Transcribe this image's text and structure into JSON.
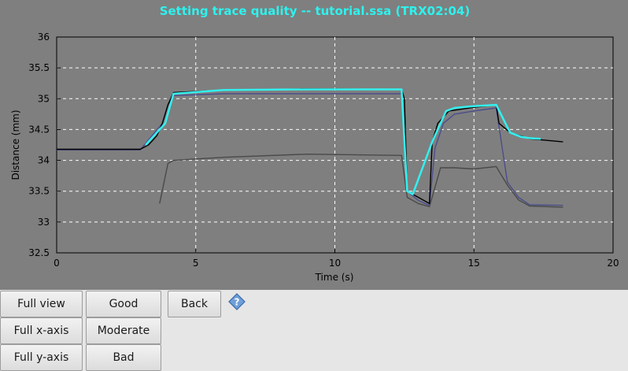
{
  "window": {
    "title": "Setting trace quality -- tutorial.ssa (TRX02:04)"
  },
  "colors": {
    "plot_background": "#7f7f7f",
    "title_color": "#2ef2ee",
    "trace_black": "#000000",
    "trace_cyan": "#33f0f0",
    "trace_blue": "#4b4d8c",
    "trace_gray": "#4a4a4a"
  },
  "chart_data": {
    "type": "line",
    "title": "Setting trace quality -- tutorial.ssa (TRX02:04)",
    "xlabel": "Time (s)",
    "ylabel": "Distance (mm)",
    "xlim": [
      0,
      20
    ],
    "ylim": [
      32.5,
      36
    ],
    "xticks": [
      0,
      5,
      10,
      15,
      20
    ],
    "yticks": [
      32.5,
      33,
      33.5,
      34,
      34.5,
      35,
      35.5,
      36
    ],
    "grid": true,
    "series": [
      {
        "color": "#000000",
        "x": [
          0,
          3.0,
          3.3,
          3.6,
          3.8,
          4.0,
          4.2,
          6,
          9,
          12.4,
          12.5,
          12.6,
          13.0,
          13.4,
          13.5,
          13.7,
          14.1,
          15,
          15.8,
          15.9,
          16.3,
          17,
          18.2
        ],
        "y": [
          34.18,
          34.18,
          34.25,
          34.4,
          34.6,
          34.9,
          35.1,
          35.14,
          35.16,
          35.15,
          35.0,
          33.5,
          33.4,
          33.3,
          34.3,
          34.6,
          34.8,
          34.86,
          34.9,
          34.6,
          34.45,
          34.35,
          34.3
        ]
      },
      {
        "color": "#33f0f0",
        "x": [
          3.2,
          3.6,
          3.9,
          4.2,
          6,
          9,
          12.4,
          12.6,
          12.8,
          13.5,
          13.8,
          14.0,
          14.3,
          15.0,
          15.8,
          16.3,
          16.7,
          17.0,
          17.4
        ],
        "y": [
          34.25,
          34.45,
          34.6,
          35.08,
          35.14,
          35.15,
          35.15,
          33.5,
          33.45,
          34.3,
          34.6,
          34.8,
          34.85,
          34.88,
          34.9,
          34.45,
          34.38,
          34.36,
          34.35
        ]
      },
      {
        "color": "#4b4d8c",
        "x": [
          0,
          3.0,
          3.8,
          4.0,
          4.2,
          6,
          9,
          12.4,
          12.6,
          13.0,
          13.4,
          13.6,
          13.9,
          14.3,
          15.0,
          15.8,
          16.2,
          16.6,
          17.0,
          18.2
        ],
        "y": [
          34.17,
          34.17,
          34.6,
          34.9,
          35.05,
          35.08,
          35.08,
          35.08,
          33.5,
          33.35,
          33.27,
          34.2,
          34.6,
          34.75,
          34.8,
          34.85,
          33.65,
          33.4,
          33.28,
          33.27
        ]
      },
      {
        "color": "#4a4a4a",
        "x": [
          3.7,
          4.0,
          4.2,
          6,
          9,
          12.4,
          12.6,
          13.0,
          13.4,
          13.8,
          14.3,
          15.0,
          15.8,
          16.2,
          16.6,
          17.0,
          18.2
        ],
        "y": [
          33.3,
          33.95,
          34.0,
          34.05,
          34.1,
          34.08,
          33.4,
          33.3,
          33.25,
          33.88,
          33.88,
          33.86,
          33.9,
          33.6,
          33.36,
          33.26,
          33.24
        ]
      }
    ]
  },
  "buttons": {
    "full_view": "Full view",
    "full_x_axis": "Full x-axis",
    "full_y_axis": "Full y-axis",
    "good": "Good",
    "moderate": "Moderate",
    "bad": "Bad",
    "back": "Back"
  }
}
